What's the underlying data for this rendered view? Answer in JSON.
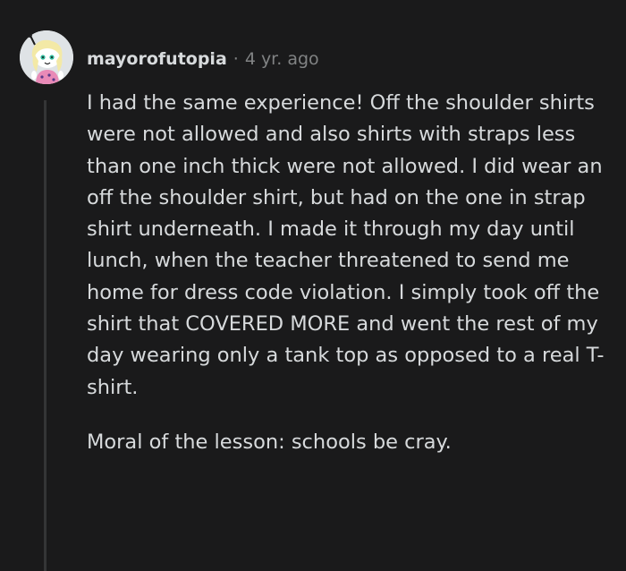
{
  "comment": {
    "author": "mayorofutopia",
    "separator": "·",
    "time": "4 yr. ago",
    "avatar_icon": "snoo-avatar-icon",
    "paragraphs": [
      "I had the same experience! Off the shoulder shirts were not allowed and also shirts with straps less than one inch thick were not allowed. I did wear an off the shoulder shirt, but had on the one in strap shirt underneath. I made it through my day until lunch, when the teacher threatened to send me home for dress code violation. I simply took off the shirt that COVERED MORE and went the rest of my day wearing only a tank top as opposed to a real T-shirt.",
      "Moral of the lesson: schools be cray."
    ]
  },
  "colors": {
    "background": "#1a1a1b",
    "text": "#d7dadc",
    "meta": "#818384",
    "thread_line": "#343536"
  }
}
